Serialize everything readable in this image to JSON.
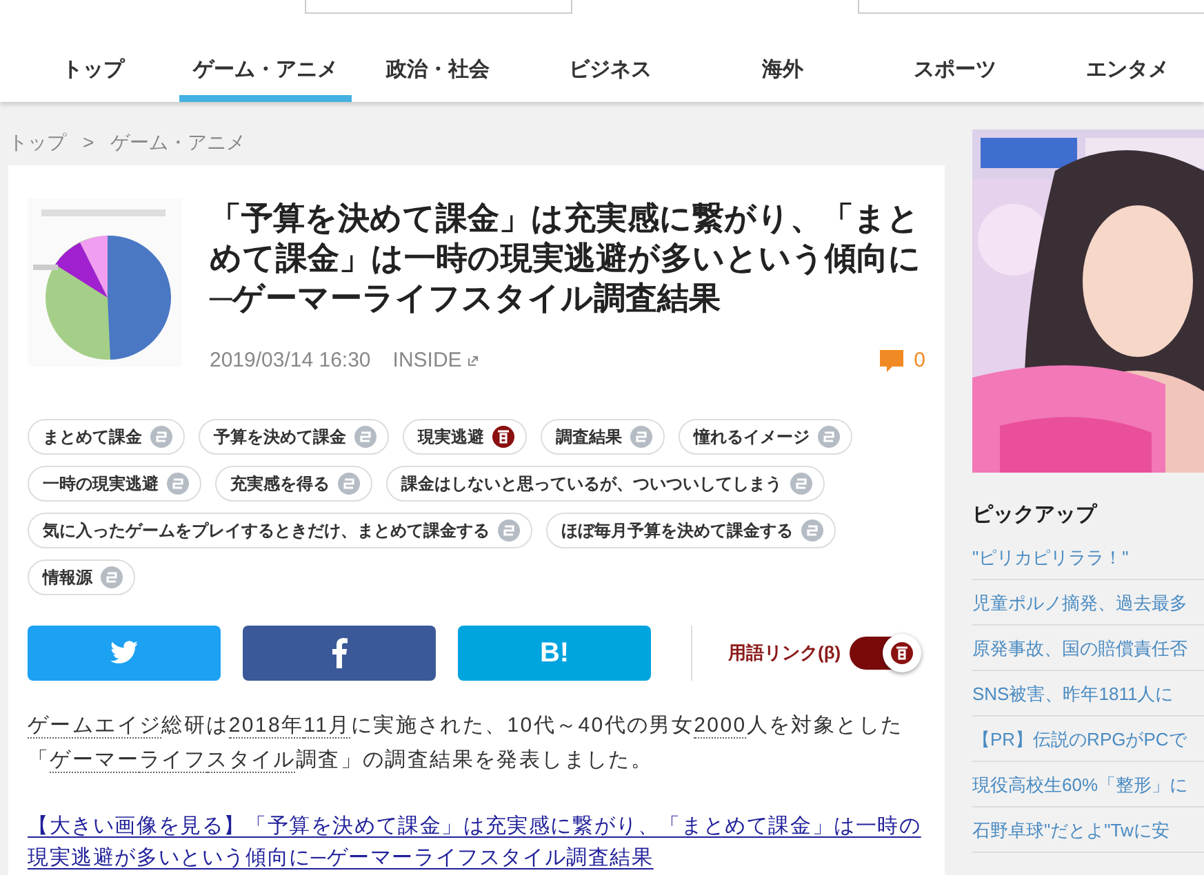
{
  "nav": {
    "tabs": [
      {
        "label": "トップ",
        "selected": false
      },
      {
        "label": "ゲーム・アニメ",
        "selected": true
      },
      {
        "label": "政治・社会",
        "selected": false
      },
      {
        "label": "ビジネス",
        "selected": false
      },
      {
        "label": "海外",
        "selected": false
      },
      {
        "label": "スポーツ",
        "selected": false
      },
      {
        "label": "エンタメ",
        "selected": false
      }
    ]
  },
  "breadcrumb": {
    "items": [
      "トップ",
      "ゲーム・アニメ"
    ],
    "separator": ">"
  },
  "article": {
    "title": "「予算を決めて課金」は充実感に繋がり、「まとめて課金」は一時の現実逃避が多いという傾向に─ゲーマーライフスタイル調査結果",
    "date": "2019/03/14 16:30",
    "source": "INSIDE",
    "comments": "0",
    "tags": [
      {
        "label": "まとめて課金",
        "linked": false
      },
      {
        "label": "予算を決めて課金",
        "linked": false
      },
      {
        "label": "現実逃避",
        "linked": true
      },
      {
        "label": "調査結果",
        "linked": false
      },
      {
        "label": "憧れるイメージ",
        "linked": false
      },
      {
        "label": "一時の現実逃避",
        "linked": false
      },
      {
        "label": "充実感を得る",
        "linked": false
      },
      {
        "label": "課金はしないと思っているが、ついついしてしまう",
        "linked": false
      },
      {
        "label": "気に入ったゲームをプレイするときだけ、まとめて課金する",
        "linked": false
      },
      {
        "label": "ほぼ毎月予算を決めて課金する",
        "linked": false
      },
      {
        "label": "情報源",
        "linked": false
      }
    ],
    "share": [
      {
        "kind": "twitter"
      },
      {
        "kind": "facebook"
      },
      {
        "kind": "hatena",
        "label": "B!"
      }
    ],
    "term_link": {
      "label": "用語リンク(β)",
      "on": true
    },
    "body": [
      {
        "text": "ゲームエイジ",
        "term": true
      },
      {
        "text": "総研は",
        "term": false
      },
      {
        "text": "2018年",
        "term": true
      },
      {
        "text": "11月",
        "term": true
      },
      {
        "text": "に実施された、10代～40代の男女",
        "term": false
      },
      {
        "text": "2000",
        "term": true
      },
      {
        "text": "人を対象とした「",
        "term": false
      },
      {
        "text": "ゲーマー",
        "term": true
      },
      {
        "text": "ライフ",
        "term": true
      },
      {
        "text": "スタイル",
        "term": true
      },
      {
        "text": "調査",
        "term": false
      },
      {
        "text": "」の調査結果を発表しました。",
        "term": false
      }
    ],
    "image_link": {
      "label": "【大きい画像を見る】",
      "text": "「予算を決めて課金」は充実感に繋がり、「まとめて課金」は一時の現実逃避が多いという傾向に─ゲーマーライフスタイル調査結果"
    }
  },
  "sidebar": {
    "pickup_title": "ピックアップ",
    "pickup": [
      "\"ピリカピリララ！\"",
      "児童ポルノ摘発、過去最多",
      "原発事故、国の賠償責任否",
      "SNS被害、昨年1811人に",
      "【PR】伝説のRPGがPCで",
      "現役高校生60%「整形」に",
      "石野卓球\"だとよ\"Twに安"
    ]
  }
}
